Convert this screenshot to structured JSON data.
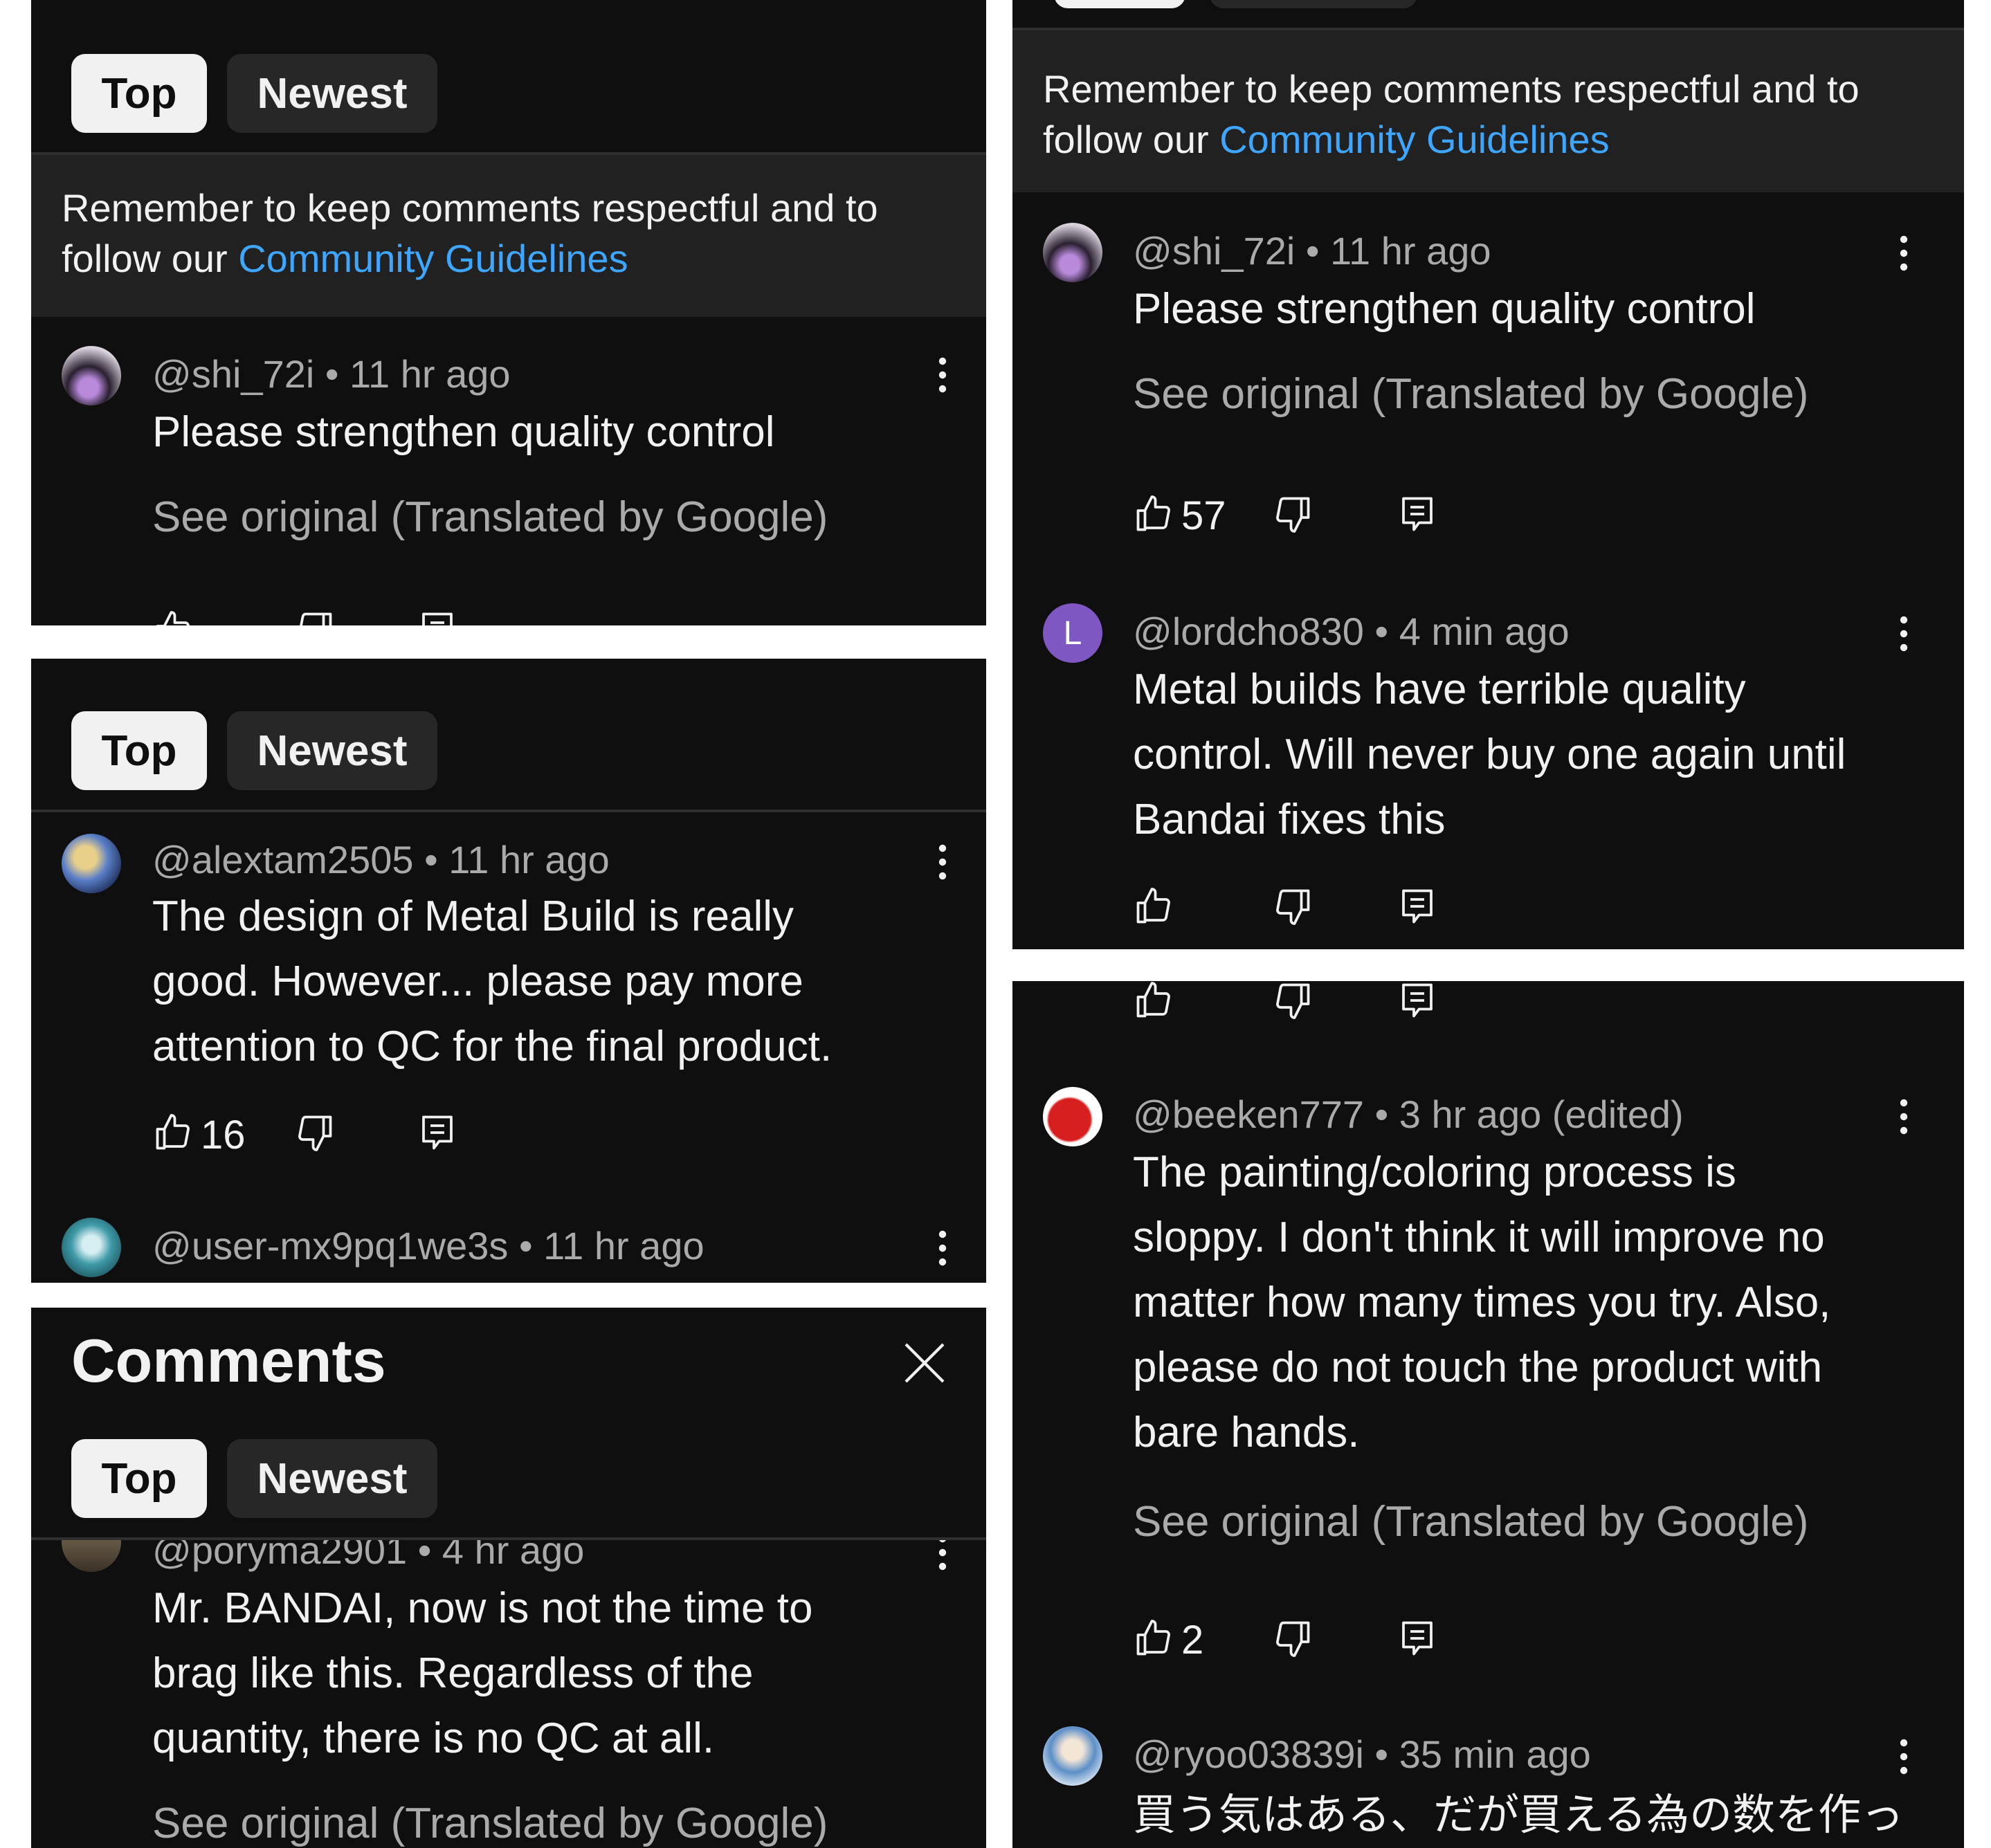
{
  "tabs": {
    "top": "Top",
    "newest": "Newest"
  },
  "notice": {
    "prefix": "Remember to keep comments respectful and to",
    "line2_prefix": "follow our ",
    "link": "Community Guidelines"
  },
  "header": {
    "title": "Comments"
  },
  "comments": {
    "shi": {
      "handle": "@shi_72i",
      "sep": "•",
      "time": "11 hr ago",
      "text": "Please strengthen quality control",
      "see_original": "See original (Translated by Google)",
      "likes": "57"
    },
    "alextam": {
      "handle": "@alextam2505",
      "sep": "•",
      "time": "11 hr ago",
      "text": "The design of Metal Build is really\ngood.  However... please pay more\nattention to QC for the final product.",
      "likes": "16"
    },
    "user_mx": {
      "handle": "@user-mx9pq1we3s",
      "sep": "•",
      "time": "11 hr ago"
    },
    "poryma": {
      "handle": "@poryma2901",
      "sep": "•",
      "time": "4 hr ago",
      "text": "Mr. BANDAI, now is not the time to\nbrag like this. Regardless of the\nquantity, there is no QC at all.",
      "see_original": "See original (Translated by Google)"
    },
    "lordcho": {
      "handle": "@lordcho830",
      "sep": "•",
      "time": "4 min ago",
      "avatar_letter": "L",
      "text": "Metal builds have terrible quality\ncontrol. Will never buy one again until\nBandai fixes this"
    },
    "beeken": {
      "handle": "@beeken777",
      "sep": "•",
      "time": "3 hr ago (edited)",
      "text": "The painting/coloring process is\nsloppy. I don't think it will improve no\nmatter how many times you try. Also,\nplease do not touch the product with\nbare hands.",
      "see_original": "See original (Translated by Google)",
      "likes": "2"
    },
    "ryoo": {
      "handle": "@ryoo03839i",
      "sep": "•",
      "time": "35 min ago",
      "text": "買う気はある、だが買える為の数を作っ"
    }
  },
  "colors": {
    "background": "#0f0f0f",
    "notice_bg": "#212121",
    "chip_active": "#f1f1f1",
    "chip_inactive": "#272727",
    "link": "#3ea6ff",
    "secondary_text": "#aaaaaa",
    "lordcho_avatar": "#7e57c2"
  },
  "icons": [
    "thumb-up-icon",
    "thumb-down-icon",
    "reply-icon",
    "more-vert-icon",
    "close-icon"
  ]
}
